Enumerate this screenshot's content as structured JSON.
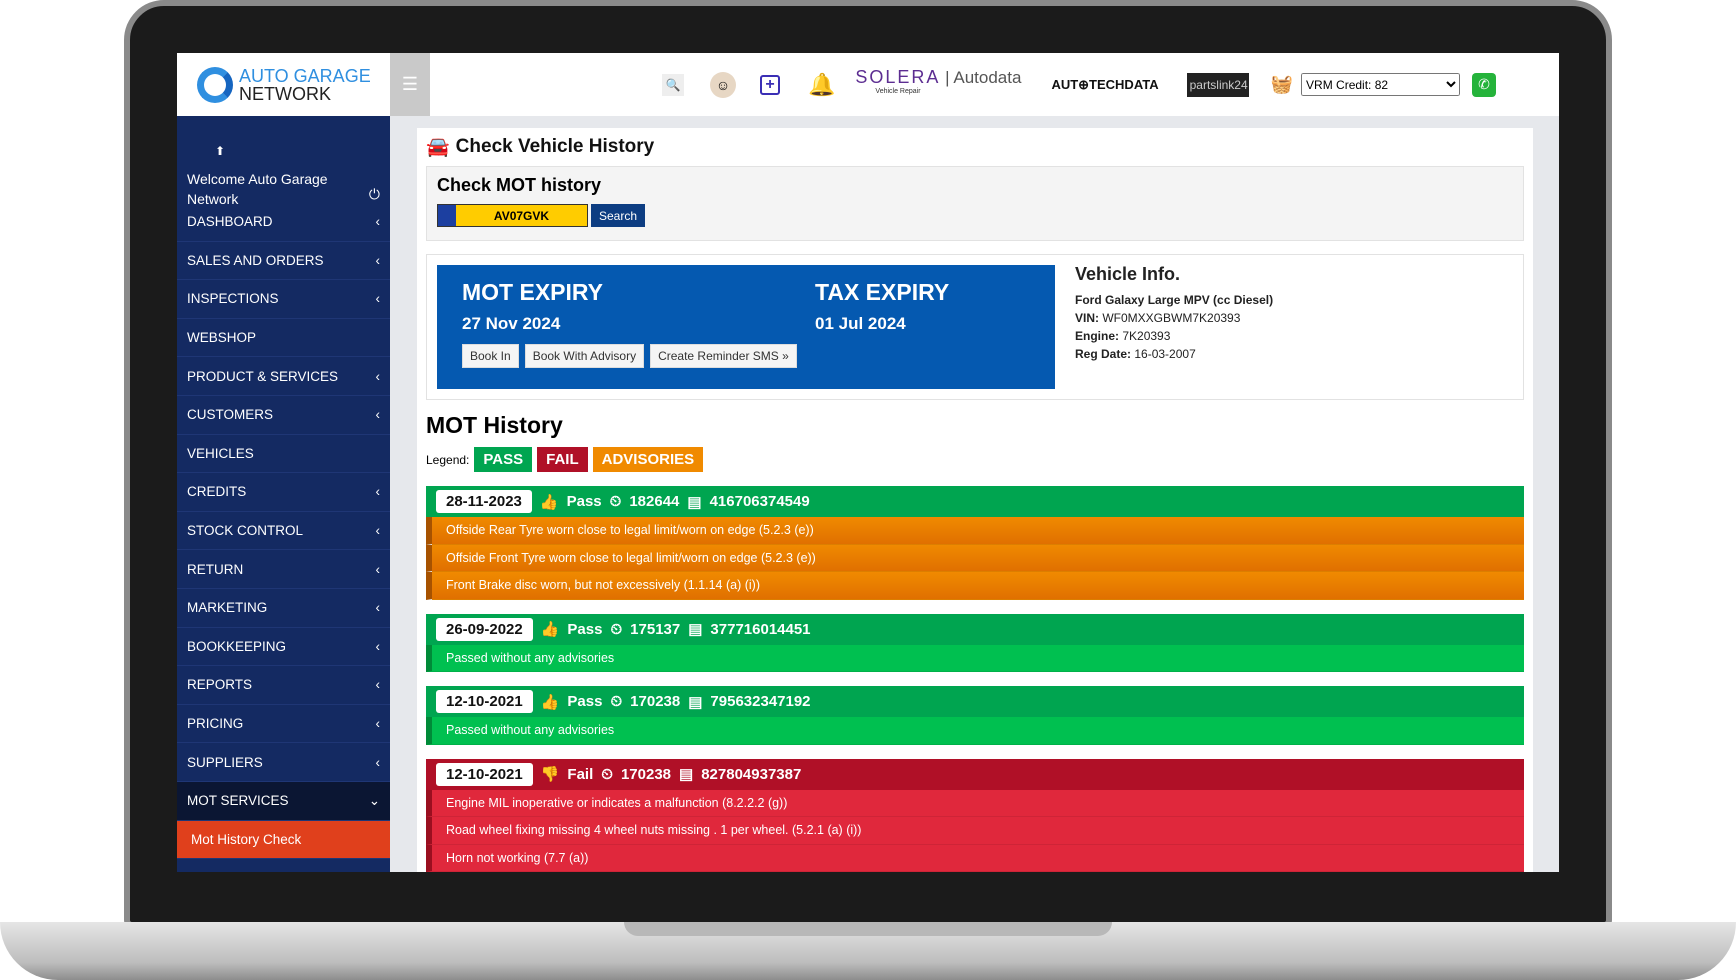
{
  "header": {
    "logo_line1": "AUTO GARAGE",
    "logo_line2": "NETWORK",
    "partners": [
      "SOLERA",
      "Vehicle Repair",
      "Autodata",
      "AUT⊕TECHDATA",
      "partslink24"
    ],
    "vrm_credit": "VRM Credit: 82"
  },
  "sidebar": {
    "welcome": "Welcome Auto Garage Network",
    "items": [
      {
        "label": "DASHBOARD",
        "chevron": "‹"
      },
      {
        "label": "SALES AND ORDERS",
        "chevron": "‹"
      },
      {
        "label": "INSPECTIONS",
        "chevron": "‹"
      },
      {
        "label": "WEBSHOP",
        "chevron": ""
      },
      {
        "label": "PRODUCT & SERVICES",
        "chevron": "‹"
      },
      {
        "label": "CUSTOMERS",
        "chevron": "‹"
      },
      {
        "label": "VEHICLES",
        "chevron": ""
      },
      {
        "label": "CREDITS",
        "chevron": "‹"
      },
      {
        "label": "STOCK CONTROL",
        "chevron": "‹"
      },
      {
        "label": "RETURN",
        "chevron": "‹"
      },
      {
        "label": "MARKETING",
        "chevron": "‹"
      },
      {
        "label": "BOOKKEEPING",
        "chevron": "‹"
      },
      {
        "label": "REPORTS",
        "chevron": "‹"
      },
      {
        "label": "PRICING",
        "chevron": "‹"
      },
      {
        "label": "SUPPLIERS",
        "chevron": "‹"
      },
      {
        "label": "MOT SERVICES",
        "chevron": "⌄"
      }
    ],
    "sub_item": "Mot History Check"
  },
  "main": {
    "title": "Check Vehicle History",
    "check_title": "Check MOT history",
    "registration": "AV07GVK",
    "search_label": "Search",
    "mot_expiry_label": "MOT EXPIRY",
    "mot_expiry": "27 Nov 2024",
    "tax_expiry_label": "TAX EXPIRY",
    "tax_expiry": "01 Jul 2024",
    "buttons": [
      "Book In",
      "Book With Advisory",
      "Create Reminder SMS »"
    ],
    "vehicle": {
      "title": "Vehicle Info.",
      "model": "Ford Galaxy Large MPV (cc Diesel)",
      "vin_label": "VIN:",
      "vin": "WF0MXXGBWM7K20393",
      "engine_label": "Engine:",
      "engine": "7K20393",
      "reg_label": "Reg Date:",
      "reg": "16-03-2007"
    },
    "history_title": "MOT History",
    "legend_label": "Legend:",
    "legend": [
      "PASS",
      "FAIL",
      "ADVISORIES"
    ],
    "records": [
      {
        "date": "28-11-2023",
        "result": "Pass",
        "mileage": "182644",
        "test_no": "416706374549",
        "items": [
          "Offside Rear Tyre worn close to legal limit/worn on edge (5.2.3 (e))",
          "Offside Front Tyre worn close to legal limit/worn on edge (5.2.3 (e))",
          "Front Brake disc worn, but not excessively (1.1.14 (a) (i))"
        ]
      },
      {
        "date": "26-09-2022",
        "result": "Pass",
        "mileage": "175137",
        "test_no": "377716014451",
        "items": [
          "Passed without any advisories"
        ]
      },
      {
        "date": "12-10-2021",
        "result": "Pass",
        "mileage": "170238",
        "test_no": "795632347192",
        "items": [
          "Passed without any advisories"
        ]
      },
      {
        "date": "12-10-2021",
        "result": "Fail",
        "mileage": "170238",
        "test_no": "827804937387",
        "items": [
          "Engine MIL inoperative or indicates a malfunction (8.2.2.2 (g))",
          "Road wheel fixing missing 4 wheel nuts missing . 1 per wheel. (5.2.1 (a) (i))",
          "Horn not working (7.7 (a))"
        ]
      }
    ]
  },
  "colors": {
    "pass": "#00a550",
    "fail": "#b01027",
    "advisory": "#f08a00",
    "sidebar": "#142a62",
    "mot_panel": "#0559b0"
  }
}
